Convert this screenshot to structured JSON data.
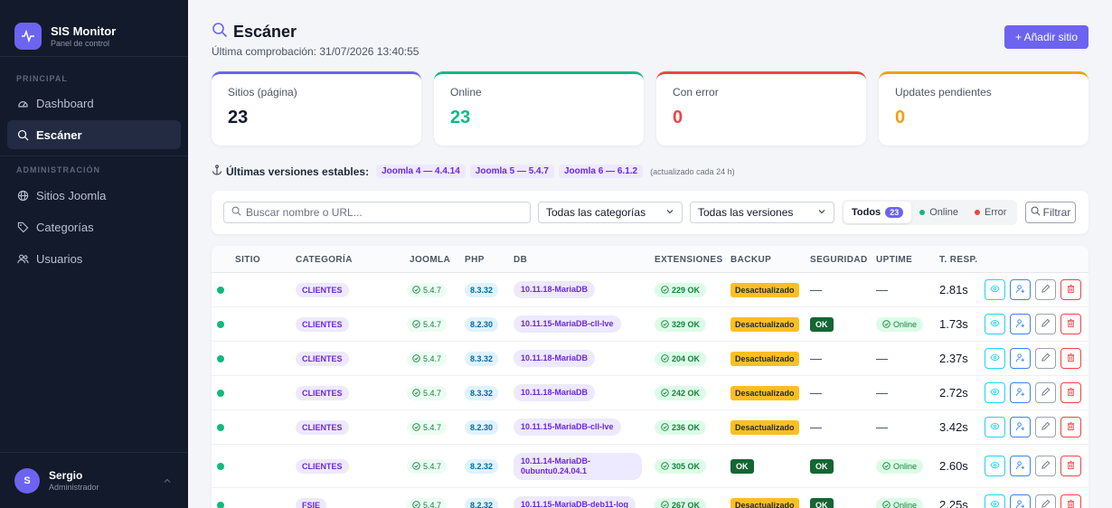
{
  "brand": {
    "title": "SIS Monitor",
    "subtitle": "Panel de control"
  },
  "sidebar": {
    "section_principal": "PRINCIPAL",
    "section_admin": "ADMINISTRACIÓN",
    "items": [
      {
        "label": "Dashboard",
        "icon": "dashboard-icon"
      },
      {
        "label": "Escáner",
        "icon": "search-icon",
        "active": true
      },
      {
        "label": "Sitios Joomla",
        "icon": "globe-icon"
      },
      {
        "label": "Categorías",
        "icon": "tag-icon"
      },
      {
        "label": "Usuarios",
        "icon": "users-icon"
      }
    ]
  },
  "user": {
    "initial": "S",
    "name": "Sergio",
    "role": "Administrador"
  },
  "header": {
    "title": "Escáner",
    "last_check": "Última comprobación: 31/07/2026 13:40:55",
    "add_button": "+ Añadir sitio"
  },
  "cards": [
    {
      "label": "Sitios (página)",
      "value": "23",
      "color": "#6c63f0"
    },
    {
      "label": "Online",
      "value": "23",
      "color": "#10b981"
    },
    {
      "label": "Con error",
      "value": "0",
      "color": "#ef4444"
    },
    {
      "label": "Updates pendientes",
      "value": "0",
      "color": "#f59e0b"
    }
  ],
  "versions": {
    "title": "Últimas versiones estables:",
    "chips": [
      "Joomla 4 — 4.4.14",
      "Joomla 5 — 5.4.7",
      "Joomla 6 — 6.1.2"
    ],
    "note": "(actualizado cada 24 h)"
  },
  "filters": {
    "search_placeholder": "Buscar nombre o URL...",
    "category_select": "Todas las categorías",
    "version_select": "Todas las versiones",
    "seg_all": "Todos",
    "seg_all_count": "23",
    "seg_online": "Online",
    "seg_error": "Error",
    "filter_button": "Filtrar"
  },
  "table": {
    "headers": [
      "SITIO",
      "CATEGORÍA",
      "JOOMLA",
      "PHP",
      "DB",
      "EXTENSIONES",
      "BACKUP",
      "SEGURIDAD",
      "UPTIME",
      "T. RESP."
    ],
    "rows": [
      {
        "category": "CLIENTES",
        "joomla": "5.4.7",
        "php": "8.3.32",
        "db": "10.11.18-MariaDB",
        "ext": "229 OK",
        "backup": "Desactualizado",
        "security": "—",
        "uptime": "—",
        "resp": "2.81s"
      },
      {
        "category": "CLIENTES",
        "joomla": "5.4.7",
        "php": "8.2.30",
        "db": "10.11.15-MariaDB-cll-lve",
        "ext": "329 OK",
        "backup": "Desactualizado",
        "security": "OK",
        "uptime": "Online",
        "resp": "1.73s"
      },
      {
        "category": "CLIENTES",
        "joomla": "5.4.7",
        "php": "8.3.32",
        "db": "10.11.18-MariaDB",
        "ext": "204 OK",
        "backup": "Desactualizado",
        "security": "—",
        "uptime": "—",
        "resp": "2.37s"
      },
      {
        "category": "CLIENTES",
        "joomla": "5.4.7",
        "php": "8.3.32",
        "db": "10.11.18-MariaDB",
        "ext": "242 OK",
        "backup": "Desactualizado",
        "security": "—",
        "uptime": "—",
        "resp": "2.72s"
      },
      {
        "category": "CLIENTES",
        "joomla": "5.4.7",
        "php": "8.2.30",
        "db": "10.11.15-MariaDB-cll-lve",
        "ext": "236 OK",
        "backup": "Desactualizado",
        "security": "—",
        "uptime": "—",
        "resp": "3.42s"
      },
      {
        "category": "CLIENTES",
        "joomla": "5.4.7",
        "php": "8.2.32",
        "db": "10.11.14-MariaDB-0ubuntu0.24.04.1",
        "ext": "305 OK",
        "backup": "OK",
        "security": "OK",
        "uptime": "Online",
        "resp": "2.60s"
      },
      {
        "category": "FSIE",
        "joomla": "5.4.7",
        "php": "8.2.32",
        "db": "10.11.15-MariaDB-deb11-log",
        "ext": "267 OK",
        "backup": "Desactualizado",
        "security": "OK",
        "uptime": "Online",
        "resp": "2.25s"
      }
    ]
  }
}
